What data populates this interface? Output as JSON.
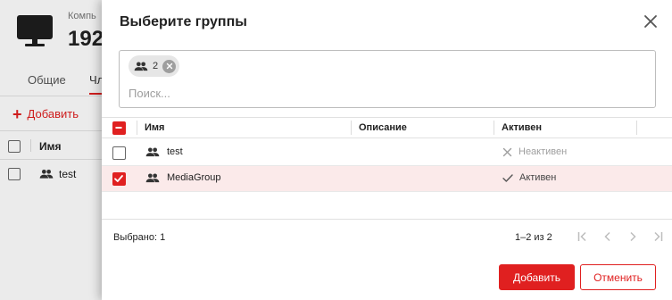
{
  "background": {
    "kicker": "Компь",
    "title": "192",
    "tabs": [
      "Общие",
      "Чл"
    ],
    "add_label": "Добавить",
    "col_name": "Имя",
    "rows": [
      {
        "name": "test"
      }
    ]
  },
  "dialog": {
    "title": "Выберите группы",
    "chips": [
      {
        "label": "2",
        "icon": "group-icon"
      }
    ],
    "search_placeholder": "Поиск...",
    "columns": {
      "name": "Имя",
      "description": "Описание",
      "active": "Активен"
    },
    "rows": [
      {
        "name": "test",
        "icon": "group-icon",
        "checked": false,
        "status": "Неактивен",
        "status_icon": "cross-icon"
      },
      {
        "name": "MediaGroup",
        "icon": "group-icon",
        "checked": true,
        "status": "Активен",
        "status_icon": "check-icon"
      }
    ],
    "selected_text": "Выбрано: 1",
    "pager": {
      "range": "1–2 из 2"
    },
    "buttons": {
      "add": "Добавить",
      "cancel": "Отменить"
    },
    "colors": {
      "accent": "#e02020",
      "selected_row": "#fbeaea"
    }
  }
}
